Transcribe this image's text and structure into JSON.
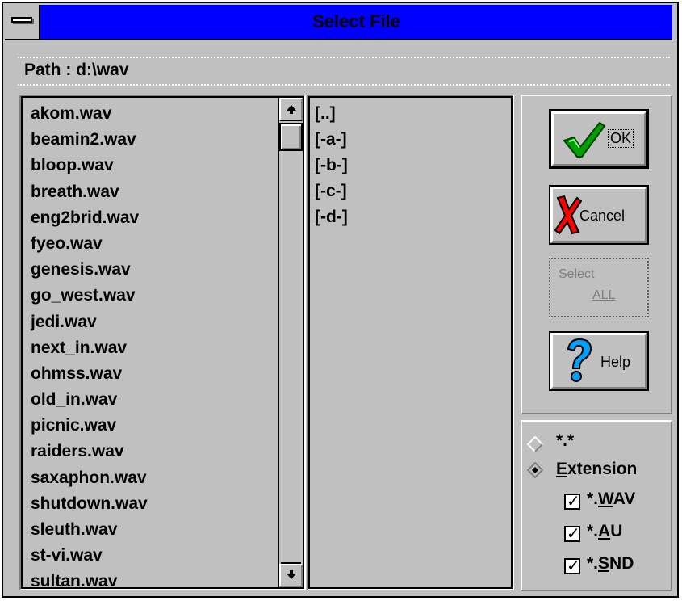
{
  "window": {
    "title": "Select File"
  },
  "path": {
    "label": "Path : d:\\wav"
  },
  "files": [
    "akom.wav",
    "beamin2.wav",
    "bloop.wav",
    "breath.wav",
    "eng2brid.wav",
    "fyeo.wav",
    "genesis.wav",
    "go_west.wav",
    "jedi.wav",
    "next_in.wav",
    "ohmss.wav",
    "old_in.wav",
    "picnic.wav",
    "raiders.wav",
    "saxaphon.wav",
    "shutdown.wav",
    "sleuth.wav",
    "st-vi.wav",
    "sultan.wav"
  ],
  "directories": [
    "[..]",
    "[-a-]",
    "[-b-]",
    "[-c-]",
    "[-d-]"
  ],
  "buttons": {
    "ok": "OK",
    "cancel": "Cancel",
    "select_all_line1": "Select",
    "select_all_line2": "ALL",
    "help": "Help"
  },
  "filter": {
    "all_label": "*.*",
    "extension_prefix": "",
    "extension_hotkey": "E",
    "extension_rest": "xtension",
    "selected": "extension",
    "ext_wav_prefix": "*.",
    "ext_wav_hotkey": "W",
    "ext_wav_rest": "AV",
    "ext_au_prefix": "*.",
    "ext_au_hotkey": "A",
    "ext_au_rest": "U",
    "ext_snd_prefix": "*.",
    "ext_snd_hotkey": "S",
    "ext_snd_rest": "ND",
    "checked": {
      "wav": true,
      "au": true,
      "snd": true
    },
    "check_glyph": "✓"
  },
  "colors": {
    "titlebar": "#0000ff",
    "face": "#c0c0c0",
    "ok_check": "#00a000",
    "cancel_x": "#ff0000",
    "help_q": "#00a0ff"
  }
}
